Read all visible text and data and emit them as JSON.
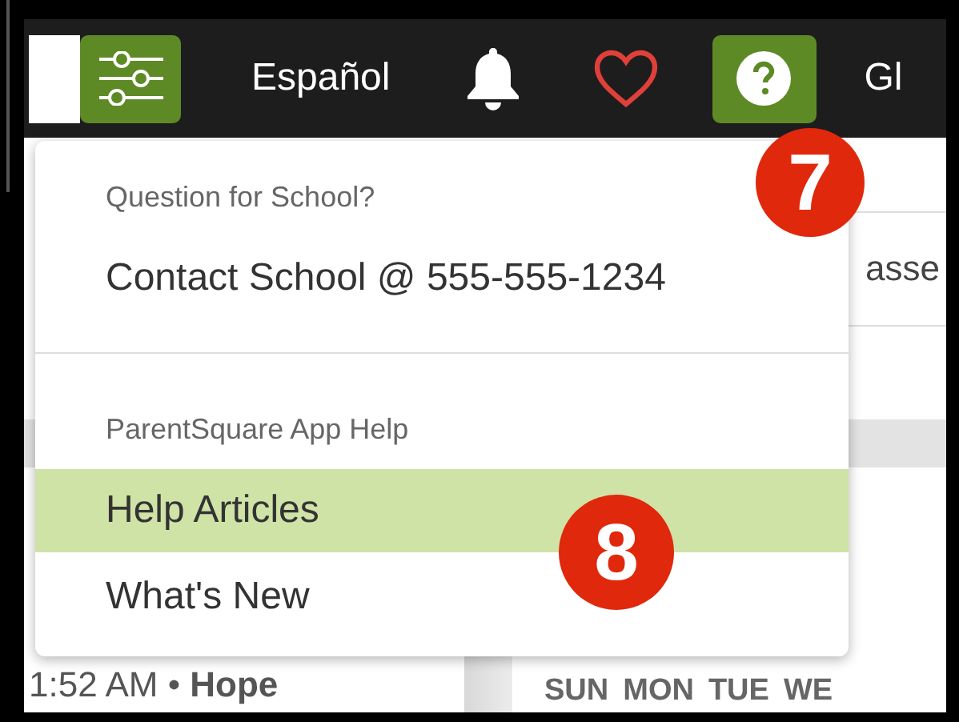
{
  "top_bar": {
    "language": "Español",
    "user_cut": "Gl"
  },
  "help_menu": {
    "sections": [
      {
        "heading": "Question for School?",
        "items": [
          {
            "label": "Contact School @ 555-555-1234",
            "selected": false
          }
        ]
      },
      {
        "heading": "ParentSquare App Help",
        "items": [
          {
            "label": "Help Articles",
            "selected": true
          },
          {
            "label": "What's New",
            "selected": false
          }
        ]
      }
    ]
  },
  "callouts": [
    "7",
    "8"
  ],
  "background": {
    "text_fragment": "asse",
    "post_meta": "1:52 AM • **Hope**",
    "weekdays": [
      "SUN",
      "MON",
      "TUE",
      "WE"
    ]
  }
}
